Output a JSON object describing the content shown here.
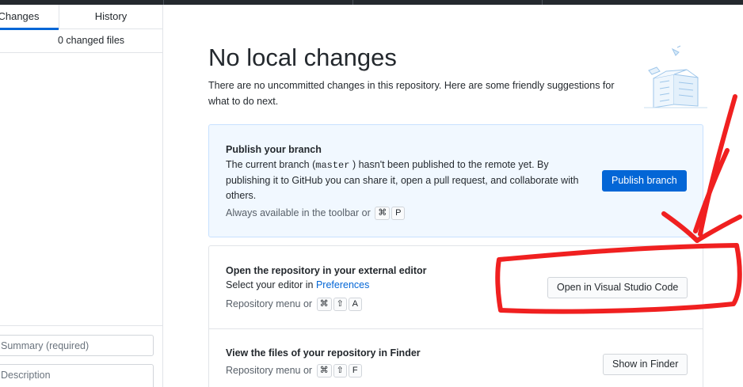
{
  "sidebar": {
    "tabs": [
      {
        "label": "Changes"
      },
      {
        "label": "History"
      }
    ],
    "changed_files": "0 changed files",
    "commit": {
      "summary_placeholder": "Summary (required)",
      "description_placeholder": "Description"
    }
  },
  "main": {
    "title": "No local changes",
    "description": "There are no uncommitted changes in this repository. Here are some friendly suggestions for what to do next.",
    "publish": {
      "title": "Publish your branch",
      "text_before": "The current branch (",
      "branch": "master",
      "text_after": ") hasn't been published to the remote yet. By publishing it to GitHub you can share it, open a pull request, and collaborate with others.",
      "hint": "Always available in the toolbar or",
      "keys": [
        "⌘",
        "P"
      ],
      "button": "Publish branch"
    },
    "editor": {
      "title": "Open the repository in your external editor",
      "text_before": "Select your editor in",
      "link": "Preferences",
      "hint": "Repository menu or",
      "keys": [
        "⌘",
        "⇧",
        "A"
      ],
      "button": "Open in Visual Studio Code"
    },
    "finder": {
      "title": "View the files of your repository in Finder",
      "hint": "Repository menu or",
      "keys": [
        "⌘",
        "⇧",
        "F"
      ],
      "button": "Show in Finder"
    }
  },
  "colors": {
    "accent": "#0366d6",
    "annotation": "#f02020",
    "publish_card_bg": "#f1f8ff"
  }
}
